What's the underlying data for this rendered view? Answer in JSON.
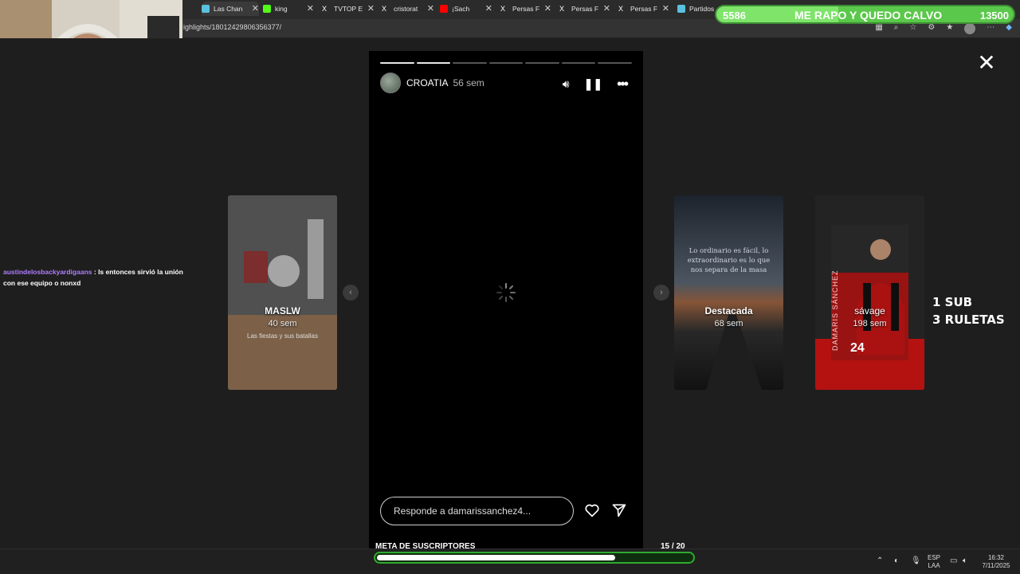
{
  "browser": {
    "tabs": [
      {
        "label": "Las Chan",
        "color": "#5bc0de"
      },
      {
        "label": "king",
        "color": "#53fc18"
      },
      {
        "label": "TVTOP E",
        "color": "#ffffff"
      },
      {
        "label": "cristorat",
        "color": "#ffffff"
      },
      {
        "label": "¡Sach",
        "color": "#ff0000"
      },
      {
        "label": "Persas F",
        "color": "#ffffff"
      },
      {
        "label": "Persas F",
        "color": "#ffffff"
      },
      {
        "label": "Persas F",
        "color": "#ffffff"
      },
      {
        "label": "Partidos",
        "color": "#5bc0de"
      }
    ],
    "url": "ighlights/18012429806356377/"
  },
  "overlay_top": {
    "left_value": "5586",
    "title": "ME RAPO Y QUEDO CALVO",
    "right_value": "13500",
    "progress": 0.41
  },
  "story": {
    "username": "CROATIA",
    "time": "56 sem",
    "progress_segments": 7,
    "progress_done": 2,
    "reply_placeholder": "Responde a damarissanchez4..."
  },
  "thumbs": [
    {
      "name": "MASLW",
      "time": "40 sem",
      "sub": "Las fiestas y sus batallas"
    },
    {
      "name": "Destacada",
      "time": "68 sem",
      "quote": "Lo ordinario es fácil, lo extraordinario es lo que nos separa de la masa"
    },
    {
      "name": "sávage",
      "time": "198 sem",
      "jersey": "24",
      "side_text": "DAMARIS SÁNCHEZ"
    }
  ],
  "promo": {
    "line1": "1 SUB",
    "line2": "3 RULETAS"
  },
  "chat": {
    "user": "austindelosbackyardigaans",
    "message": ": ls entonces sirvió la unión con ese equipo o nonxd"
  },
  "meta": {
    "label": "META DE SUSCRIPTORES",
    "count": "15  / 20",
    "progress": 0.75
  },
  "tray": {
    "lang": "ESP",
    "layout": "LAA",
    "time": "16:32",
    "date": "7/11/2025"
  }
}
